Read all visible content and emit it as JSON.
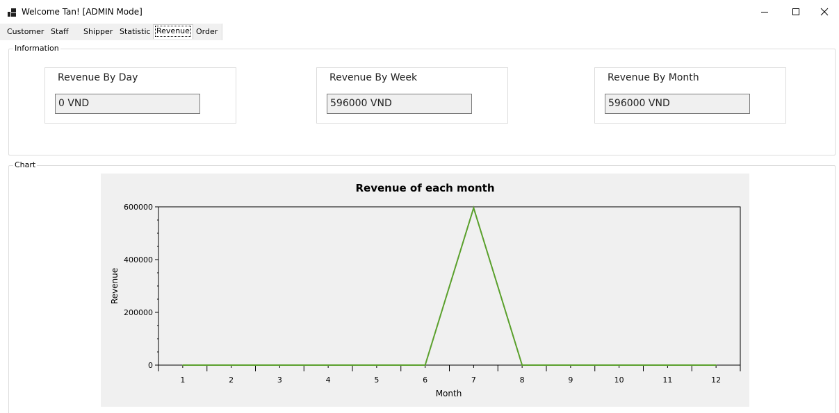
{
  "window": {
    "title": "Welcome Tan! [ADMIN Mode]",
    "controls": {
      "minimize": "minimize-icon",
      "maximize": "maximize-icon",
      "close": "close-icon"
    }
  },
  "tabs": [
    {
      "label": "Customer",
      "active": false
    },
    {
      "label": "Staff",
      "active": false
    },
    {
      "label": "Shipper",
      "active": false
    },
    {
      "label": "Statistic",
      "active": false
    },
    {
      "label": "Revenue",
      "active": true
    },
    {
      "label": "Order",
      "active": false
    }
  ],
  "information": {
    "legend": "Information",
    "by_day": {
      "label": "Revenue By Day",
      "value": "0 VND"
    },
    "by_week": {
      "label": "Revenue By Week",
      "value": "596000 VND"
    },
    "by_month": {
      "label": "Revenue By Month",
      "value": "596000 VND"
    }
  },
  "chart_section": {
    "legend": "Chart"
  },
  "chart_data": {
    "type": "line",
    "title": "Revenue of each month",
    "xlabel": "Month",
    "ylabel": "Revenue",
    "x": [
      1,
      2,
      3,
      4,
      5,
      6,
      7,
      8,
      9,
      10,
      11,
      12
    ],
    "series": [
      {
        "values": [
          0,
          0,
          0,
          0,
          0,
          0,
          596000,
          0,
          0,
          0,
          0,
          0
        ],
        "color": "#5aa02c"
      }
    ],
    "xlim": [
      0.5,
      12.5
    ],
    "ylim": [
      0,
      600000
    ],
    "yticks": [
      "0",
      "200000",
      "400000",
      "600000"
    ],
    "grid": false,
    "background": "#f0f0f0"
  }
}
